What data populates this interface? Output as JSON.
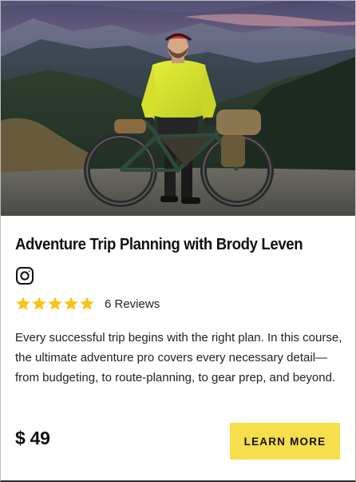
{
  "card": {
    "image": {
      "alt": "Cyclist in a yellow jacket standing behind a loaded bikepacking bike on a mountain overlook at dusk"
    },
    "title": "Adventure Trip Planning with Brody Leven",
    "social_icon": "instagram-icon",
    "rating": {
      "stars": 5,
      "max_stars": 5,
      "star_color": "#f5c518",
      "reviews_label": "6 Reviews"
    },
    "description": "Every successful trip begins with the right plan. In this course, the ultimate adventure pro covers every necessary detail—from budgeting, to route-planning, to gear prep, and beyond.",
    "price": "$ 49",
    "cta_label": "LEARN MORE",
    "cta_color": "#f6de4c"
  }
}
